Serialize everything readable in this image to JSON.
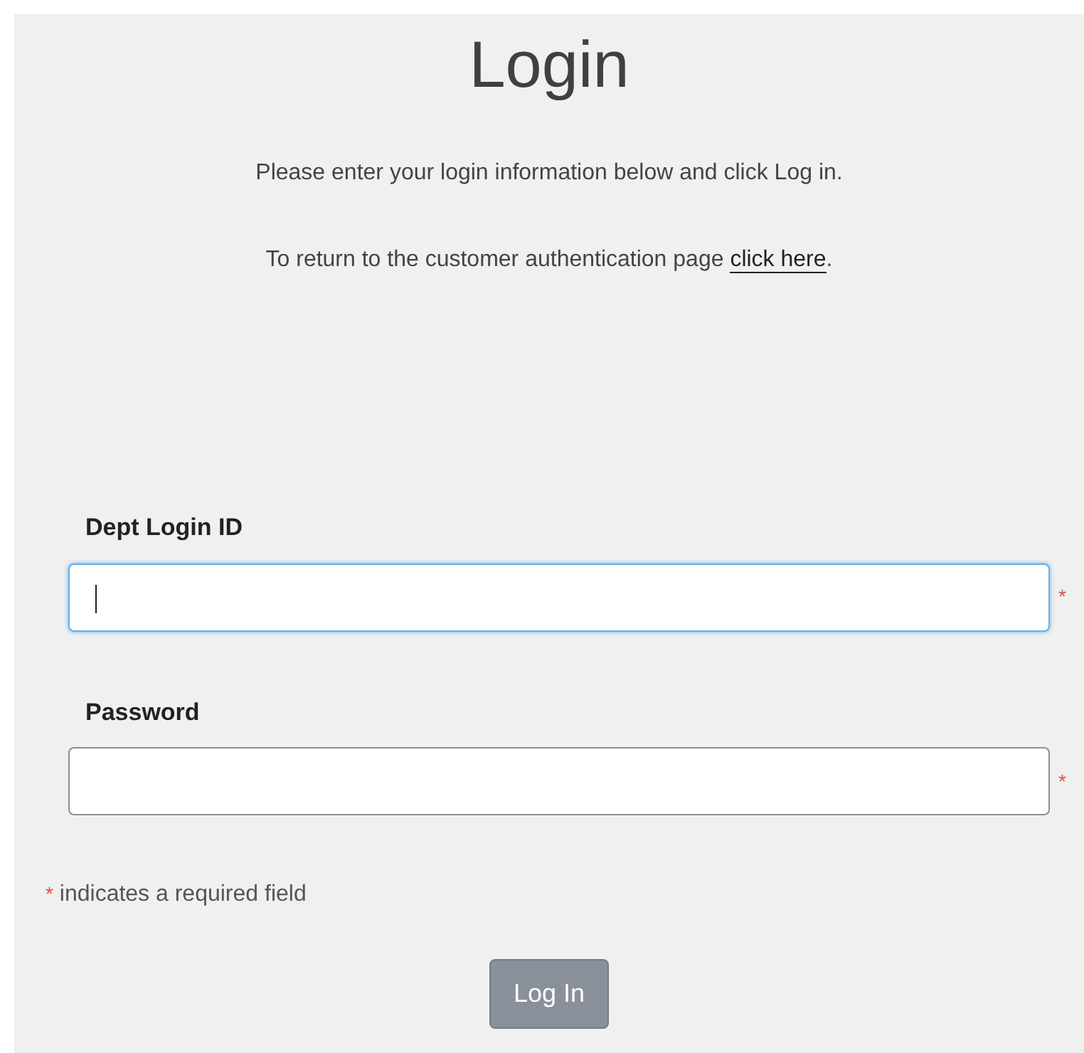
{
  "title": "Login",
  "intro": "Please enter your login information below and click Log in.",
  "return_note": {
    "text": "To return to the customer authentication page ",
    "link": "click here",
    "after": "."
  },
  "fields": [
    {
      "label": "Dept Login ID",
      "focused": true,
      "required_mark": "*"
    },
    {
      "label": "Password",
      "focused": false,
      "required_mark": "*"
    }
  ],
  "required_note": {
    "mark": "*",
    "text": "indicates a required field"
  },
  "button": {
    "label": "Log In"
  }
}
